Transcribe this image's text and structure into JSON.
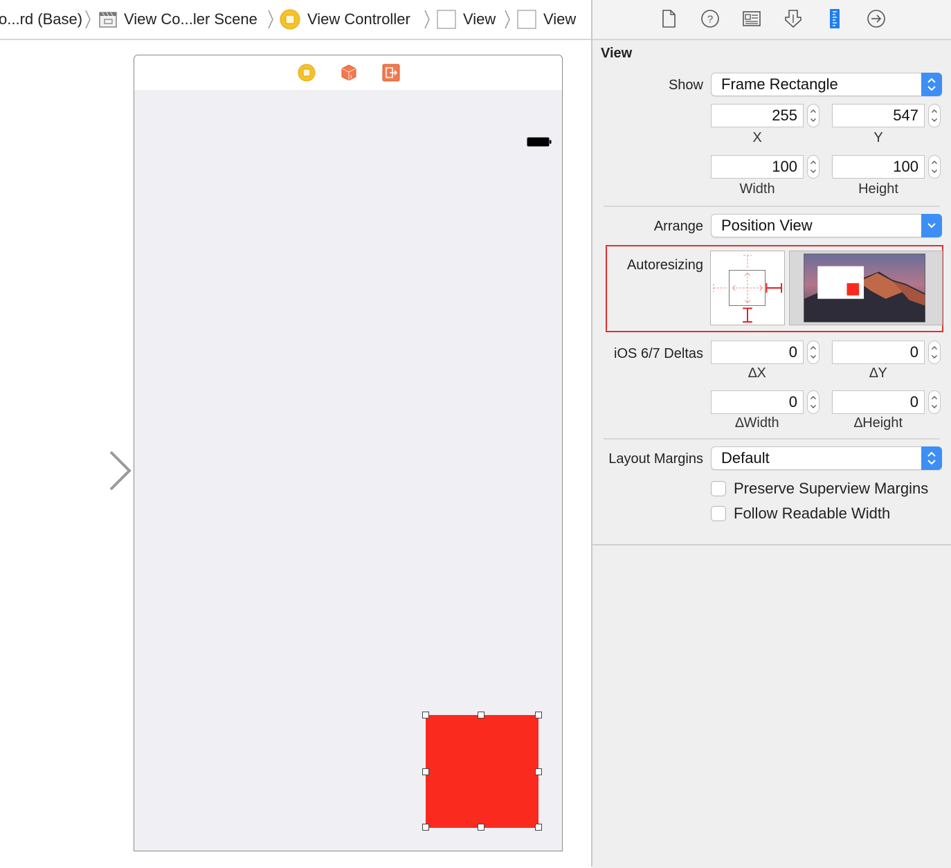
{
  "breadcrumb": {
    "items": [
      {
        "label": "o...rd (Base)",
        "icon": "storyboard-icon"
      },
      {
        "label": "View Co...ler Scene",
        "icon": "scene-icon"
      },
      {
        "label": "View Controller",
        "icon": "view-controller-icon"
      },
      {
        "label": "View",
        "icon": "view-icon"
      },
      {
        "label": "View",
        "icon": "view-icon"
      }
    ]
  },
  "inspector": {
    "tabs": [
      {
        "name": "file-inspector",
        "icon": "file-icon"
      },
      {
        "name": "quick-help",
        "icon": "help-icon"
      },
      {
        "name": "identity-inspector",
        "icon": "identity-card-icon"
      },
      {
        "name": "attributes-inspector",
        "icon": "attributes-icon"
      },
      {
        "name": "size-inspector",
        "icon": "ruler-icon",
        "selected": true
      },
      {
        "name": "connections-inspector",
        "icon": "arrow-circle-icon"
      }
    ],
    "section_title": "View",
    "show": {
      "label": "Show",
      "value": "Frame Rectangle"
    },
    "frame": {
      "x": {
        "value": "255",
        "label": "X"
      },
      "y": {
        "value": "547",
        "label": "Y"
      },
      "width": {
        "value": "100",
        "label": "Width"
      },
      "height": {
        "value": "100",
        "label": "Height"
      }
    },
    "arrange": {
      "label": "Arrange",
      "value": "Position View"
    },
    "autoresizing": {
      "label": "Autoresizing"
    },
    "deltas": {
      "label": "iOS 6/7 Deltas",
      "dx": {
        "value": "0",
        "label": "∆X"
      },
      "dy": {
        "value": "0",
        "label": "∆Y"
      },
      "dwidth": {
        "value": "0",
        "label": "∆Width"
      },
      "dheight": {
        "value": "0",
        "label": "∆Height"
      }
    },
    "layout_margins": {
      "label": "Layout Margins",
      "value": "Default"
    },
    "preserve_superview_margins": {
      "label": "Preserve Superview Margins",
      "checked": false
    },
    "follow_readable_width": {
      "label": "Follow Readable Width",
      "checked": false
    }
  },
  "colors": {
    "accent_blue": "#3d8ff5",
    "red_view": "#fb2a1e",
    "highlight_red": "#e03030",
    "canvas_bg": "#efeff4"
  }
}
